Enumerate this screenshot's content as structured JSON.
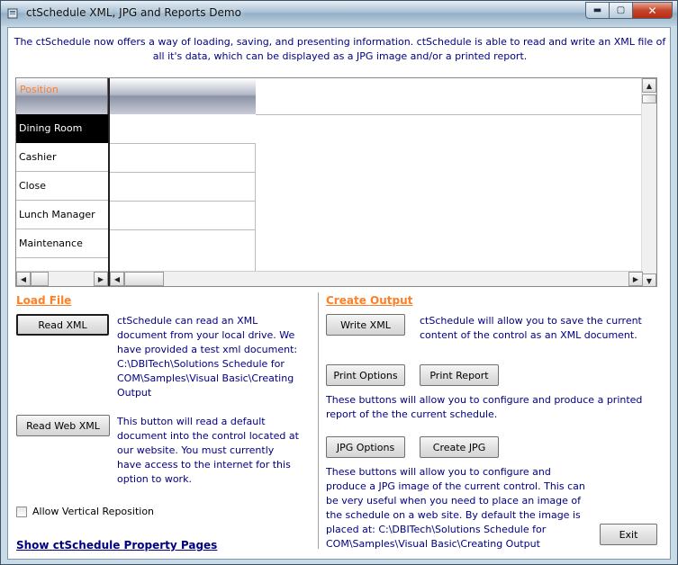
{
  "window": {
    "title": "ctSchedule XML, JPG and Reports Demo",
    "min_glyph": "▬",
    "max_glyph": "▢",
    "close_glyph": "✕"
  },
  "intro": {
    "line1": "The ctSchedule now offers a way of loading, saving, and presenting information. ctSchedule is able to read and write an XML file of",
    "line2": "all it's data, which can be displayed as a JPG image and/or a printed report."
  },
  "schedule": {
    "header_label": "Position",
    "rows": [
      "Dining Room",
      "Cashier",
      "Close",
      "Lunch Manager",
      "Maintenance"
    ],
    "selected_row": 0
  },
  "load_file": {
    "label": "Load File",
    "read_xml_button": "Read XML",
    "read_xml_desc": [
      "ctSchedule can read an XML",
      "document from your local drive. We",
      "have provided a test xml document:",
      "C:\\DBITech\\Solutions Schedule for",
      "COM\\Samples\\Visual Basic\\Creating",
      "Output"
    ],
    "read_web_xml_button": "Read Web XML",
    "read_web_xml_desc": [
      "This button will read a default",
      "document into the control located at",
      "our website.  You must currently",
      "have access to the internet for this",
      "option to work."
    ],
    "allow_vertical_reposition": "Allow Vertical Reposition",
    "property_pages_link": "Show ctSchedule Property Pages"
  },
  "create_output": {
    "label": "Create Output",
    "write_xml_button": "Write XML",
    "write_xml_desc": [
      "ctSchedule will allow you to save the current",
      "content of the control as an XML document."
    ],
    "print_options_button": "Print Options",
    "print_report_button": "Print Report",
    "print_desc": [
      "These buttons will allow you to configure and produce a printed",
      "report of the the current schedule."
    ],
    "jpg_options_button": "JPG Options",
    "create_jpg_button": "Create JPG",
    "jpg_desc": [
      "These buttons will allow you to configure and",
      "produce a JPG image of the current control. This can",
      "be very useful when you need to place an image of",
      "the schedule on a web site.  By default the image is",
      "placed at: C:\\DBITech\\Solutions Schedule for",
      "COM\\Samples\\Visual Basic\\Creating Output"
    ],
    "exit_button": "Exit"
  }
}
